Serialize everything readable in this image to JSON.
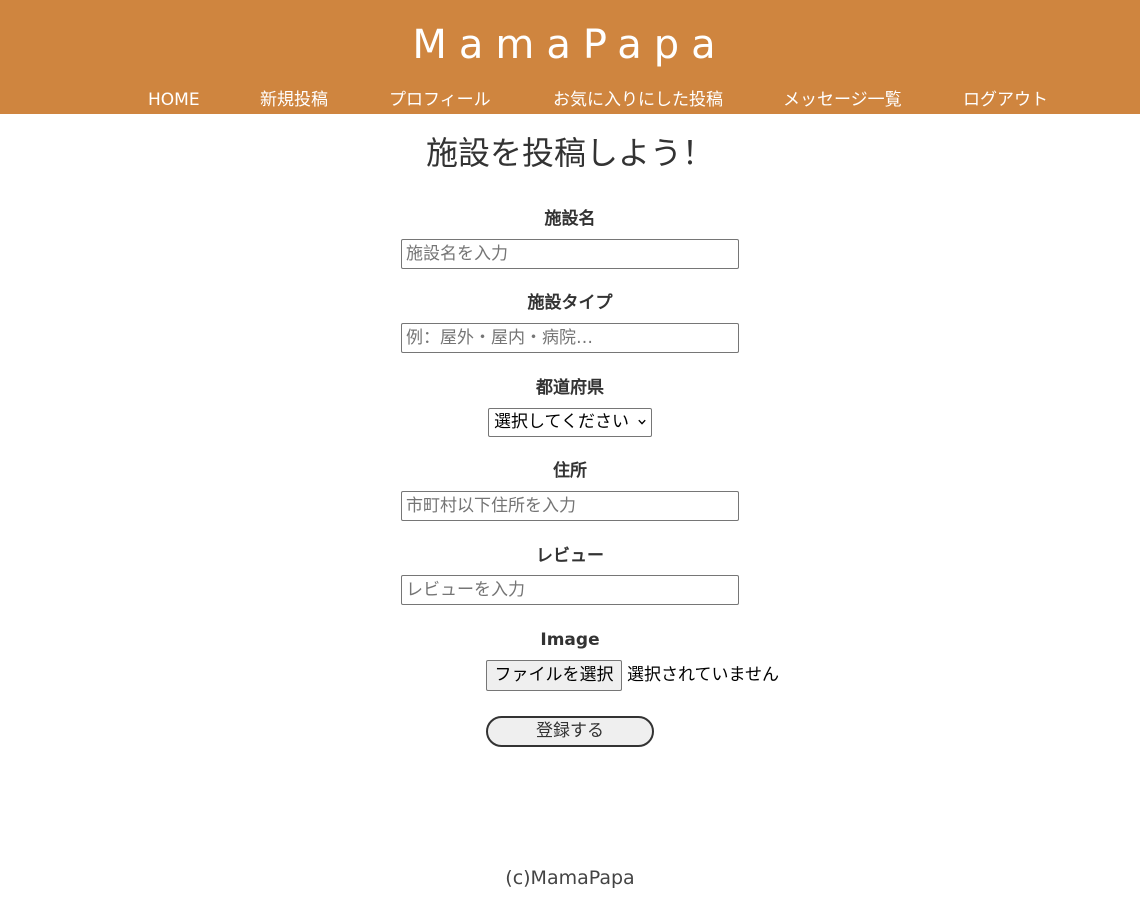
{
  "header": {
    "logo": "MamaPapa",
    "nav": [
      {
        "label": "HOME"
      },
      {
        "label": "新規投稿"
      },
      {
        "label": "プロフィール"
      },
      {
        "label": "お気に入りにした投稿"
      },
      {
        "label": "メッセージ一覧"
      },
      {
        "label": "ログアウト"
      }
    ],
    "bg_color": "#cf853f"
  },
  "main": {
    "title": "施設を投稿しよう！",
    "form": {
      "name": {
        "label": "施設名",
        "placeholder": "施設名を入力"
      },
      "type": {
        "label": "施設タイプ",
        "placeholder": "例：屋外・屋内・病院…"
      },
      "prefecture": {
        "label": "都道府県",
        "selected": "選択してください"
      },
      "address": {
        "label": "住所",
        "placeholder": "市町村以下住所を入力"
      },
      "review": {
        "label": "レビュー",
        "placeholder": "レビューを入力"
      },
      "image": {
        "label": "Image",
        "button": "ファイルを選択",
        "status": "選択されていません"
      },
      "submit": "登録する"
    }
  },
  "footer": {
    "text": "(c)MamaPapa"
  }
}
